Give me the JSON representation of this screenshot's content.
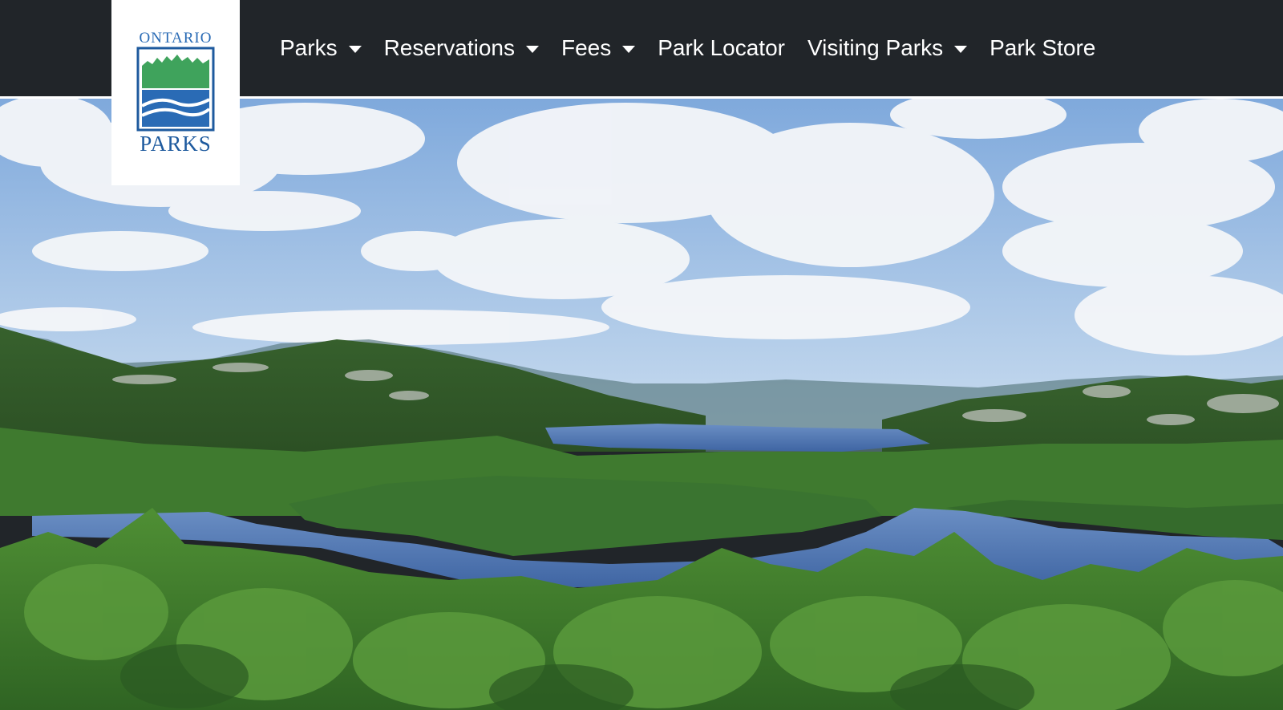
{
  "logo": {
    "top_text": "ONTARIO",
    "bottom_text": "PARKS",
    "colors": {
      "green": "#3fa35c",
      "blue": "#2a6bb5",
      "text": "#1e5a9e"
    }
  },
  "nav": {
    "items": [
      {
        "label": "Parks",
        "has_dropdown": true
      },
      {
        "label": "Reservations",
        "has_dropdown": true
      },
      {
        "label": "Fees",
        "has_dropdown": true
      },
      {
        "label": "Park Locator",
        "has_dropdown": false
      },
      {
        "label": "Visiting Parks",
        "has_dropdown": true
      },
      {
        "label": "Park Store",
        "has_dropdown": false
      }
    ],
    "background": "#212529",
    "text_color": "#ffffff"
  },
  "hero": {
    "icon": "landscape-photo",
    "colors": {
      "sky": "#8fb6e3",
      "cloud": "#f4f6f9",
      "forest": "#3f7a2f",
      "water": "#4f73ad"
    }
  }
}
